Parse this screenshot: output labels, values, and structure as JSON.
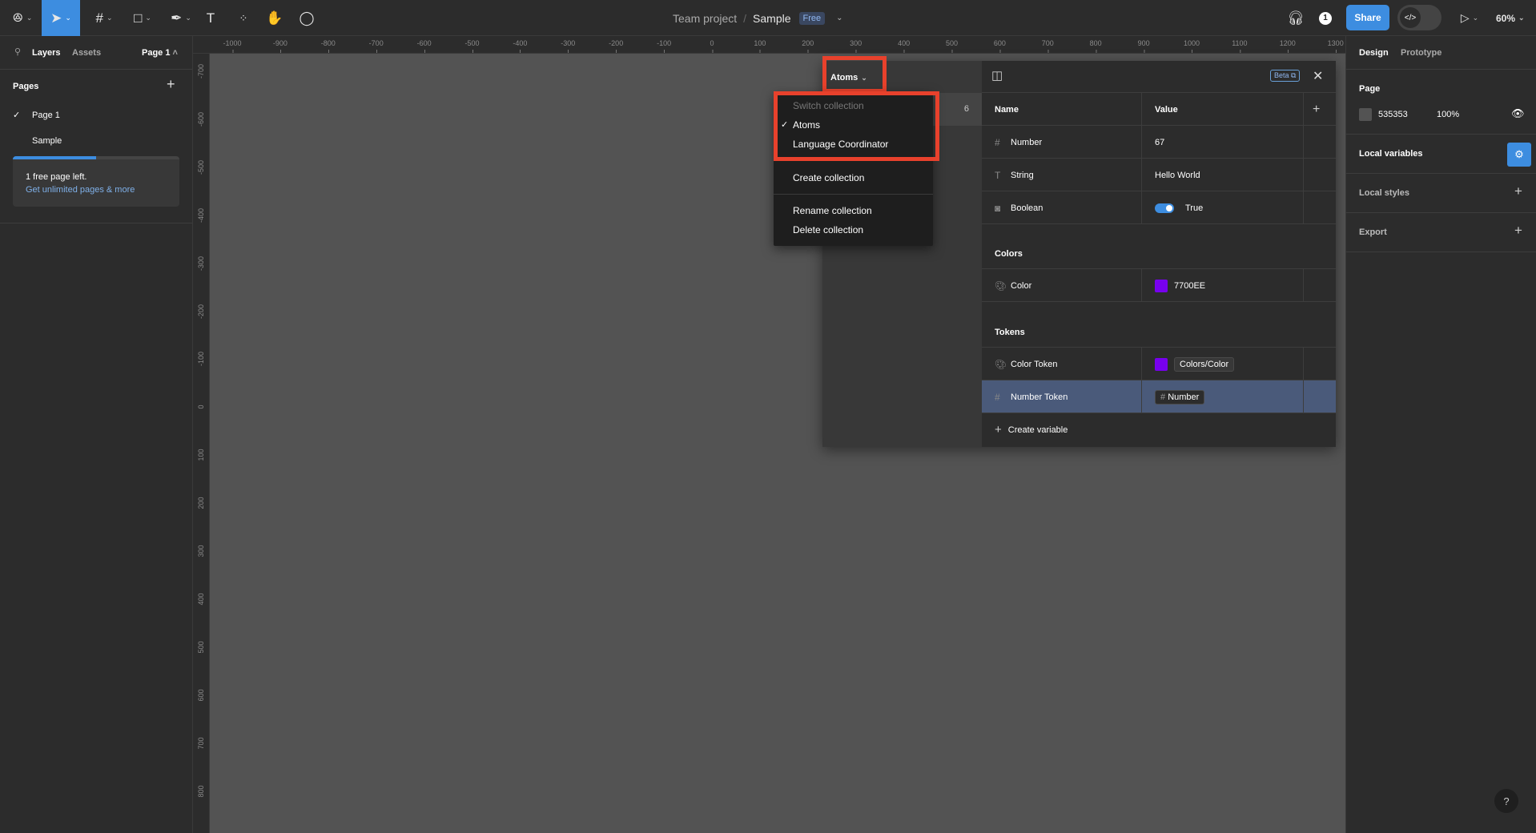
{
  "toolbar": {
    "title_project": "Team project",
    "separator": "/",
    "title_file": "Sample",
    "plan_badge": "Free",
    "share": "Share",
    "zoom": "60%",
    "avatar_initial": "1",
    "dev_mode_icon": "</>"
  },
  "left_panel": {
    "tabs": [
      "Layers",
      "Assets"
    ],
    "page_selector": "Page 1",
    "pages_header": "Pages",
    "pages": [
      {
        "name": "Page 1",
        "selected": true
      },
      {
        "name": "Sample",
        "selected": false
      }
    ],
    "upsell": {
      "text": "1 free page left.",
      "link": "Get unlimited pages & more",
      "progress": 0.5
    }
  },
  "ruler": {
    "top": [
      "-1000",
      "-900",
      "-800",
      "-700",
      "-600",
      "-500",
      "-400",
      "-300",
      "-200",
      "-100",
      "0",
      "100",
      "200",
      "300",
      "400",
      "500",
      "600",
      "700",
      "800",
      "900",
      "1000",
      "1100",
      "1200",
      "1300"
    ],
    "left": [
      "-700",
      "-600",
      "-500",
      "-400",
      "-300",
      "-200",
      "-100",
      "0",
      "100",
      "200",
      "300",
      "400",
      "500",
      "600",
      "700",
      "800"
    ]
  },
  "dialog": {
    "collection": "Atoms",
    "mode_count": "6",
    "beta": "Beta",
    "headers": {
      "name": "Name",
      "value": "Value"
    },
    "rows": [
      {
        "icon": "#",
        "name": "Number",
        "value": "67"
      },
      {
        "icon": "T",
        "name": "String",
        "value": "Hello World"
      },
      {
        "icon": "◙",
        "name": "Boolean",
        "value": "True"
      }
    ],
    "groups": [
      {
        "label": "Colors",
        "rows": [
          {
            "name": "Color",
            "value": "7700EE"
          }
        ]
      },
      {
        "label": "Tokens",
        "rows": [
          {
            "name": "Color Token",
            "value": "Colors/Color"
          },
          {
            "name": "Number Token",
            "value": "Number"
          }
        ]
      }
    ],
    "create_variable": "Create variable",
    "swatch_color": "#7700EE"
  },
  "menu": {
    "header": "Switch collection",
    "items": [
      "Atoms",
      "Language Coordinator"
    ],
    "checked": "Atoms",
    "actions": [
      "Create collection",
      "Rename collection",
      "Delete collection"
    ]
  },
  "right_panel": {
    "tabs": [
      "Design",
      "Prototype"
    ],
    "page_label": "Page",
    "page_color": "535353",
    "page_opacity": "100%",
    "local_variables": "Local variables",
    "local_styles": "Local styles",
    "export": "Export",
    "help": "?"
  },
  "colors": {
    "accent": "#3d8de0",
    "highlight_box": "#e8412c",
    "selected_row": "#4a5a7a"
  }
}
